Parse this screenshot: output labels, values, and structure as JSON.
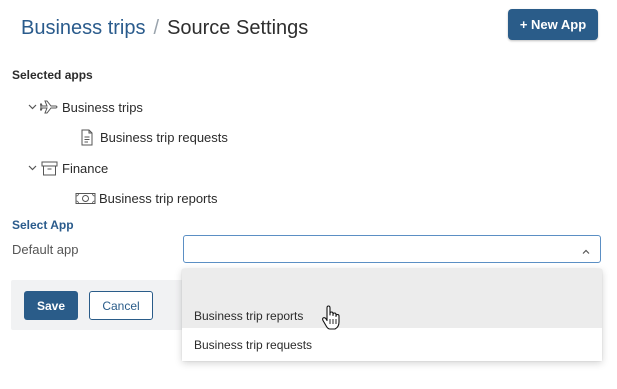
{
  "header": {
    "breadcrumb_parent": "Business trips",
    "separator": "/",
    "page_title": "Source Settings",
    "new_app_label": "+ New App"
  },
  "selected_apps": {
    "title": "Selected apps",
    "groups": [
      {
        "label": "Business trips",
        "icon": "airplane-icon",
        "expanded": true,
        "children": [
          {
            "label": "Business trip requests",
            "icon": "document-icon"
          }
        ]
      },
      {
        "label": "Finance",
        "icon": "archive-box-icon",
        "expanded": true,
        "children": [
          {
            "label": "Business trip reports",
            "icon": "banknote-icon"
          }
        ]
      }
    ]
  },
  "select_app": {
    "title": "Select App",
    "default_app_label": "Default app",
    "value": "",
    "options": [
      "",
      "Business trip reports",
      "Business trip requests"
    ],
    "hovered_option": "Business trip reports"
  },
  "footer": {
    "save_label": "Save",
    "cancel_label": "Cancel"
  },
  "colors": {
    "accent": "#2a5c89",
    "link": "#2a5b8c",
    "select_border": "#5b8fc4",
    "hover_bg": "#ececec"
  }
}
